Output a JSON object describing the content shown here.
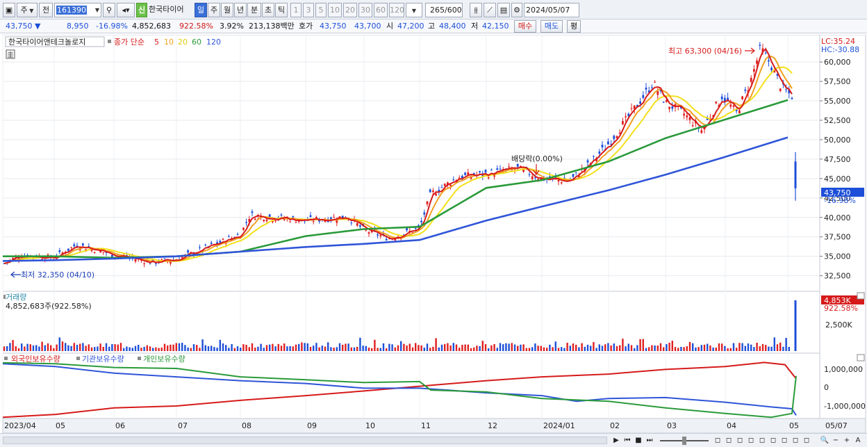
{
  "toolbar": {
    "period_unit": "주",
    "prev_label": "전",
    "code": "161390",
    "new_badge": "신",
    "stock_name": "한국타이어",
    "tabs": [
      "일",
      "주",
      "월",
      "년",
      "분",
      "초",
      "틱"
    ],
    "active_tab": "일",
    "intervals": [
      "1",
      "3",
      "5",
      "10",
      "20",
      "30",
      "60",
      "120"
    ],
    "count": "265",
    "count_total": "/600",
    "date": "2024/05/07"
  },
  "info": {
    "price": "43,750",
    "change": "8,950",
    "change_pct": "-16.98%",
    "volume": "4,852,683",
    "volume_pct": "922.58%",
    "turnover_pct": "3.92%",
    "amount": "213,138백만",
    "quote_label": "호가",
    "ask": "43,750",
    "bid": "43,700",
    "open_label": "시",
    "open": "47,200",
    "high_label": "고",
    "high": "48,400",
    "low_label": "저",
    "low": "42,150",
    "buy_label": "매수",
    "sell_label": "매도",
    "eval_label": "평"
  },
  "chart_data": {
    "type": "line",
    "title": "한국타이어앤테크놀로지",
    "ma_legend_prefix": "종가 단순",
    "ma_periods": [
      "5",
      "10",
      "20",
      "60",
      "120"
    ],
    "ma_colors": {
      "5": "#d61a1a",
      "10": "#f0a020",
      "20": "#f2e01a",
      "60": "#2a9a3a",
      "120": "#2f55d8"
    },
    "y_ticks": [
      "60,000",
      "57,500",
      "55,000",
      "52,500",
      "50,000",
      "47,500",
      "45,000",
      "42,500",
      "40,000",
      "37,500",
      "35,000",
      "32,500"
    ],
    "ylim": [
      30500,
      63500
    ],
    "x_labels": [
      "2023/04",
      "05",
      "06",
      "07",
      "08",
      "09",
      "10",
      "11",
      "12",
      "2024/01",
      "02",
      "03",
      "04",
      "05",
      "05/07"
    ],
    "high_annotation": "최고 63,300 (04/16)",
    "low_annotation": "최저 32,350 (04/10)",
    "dividend_annotation": "배당락(0.00%)",
    "lc_label": "LC:35.24",
    "hc_label": "HC:-30.88",
    "last_price_label": "43,750",
    "last_change_label": "-16.98%",
    "ma60": [
      {
        "x": "2023/04",
        "y": 35000
      },
      {
        "x": "2023/05",
        "y": 35000
      },
      {
        "x": "2023/06",
        "y": 34800
      },
      {
        "x": "2023/07",
        "y": 35000
      },
      {
        "x": "2023/08",
        "y": 35600
      },
      {
        "x": "2023/09",
        "y": 37600
      },
      {
        "x": "2023/10",
        "y": 38500
      },
      {
        "x": "2023/11",
        "y": 38800
      },
      {
        "x": "2023/12",
        "y": 43800
      },
      {
        "x": "2024/01",
        "y": 44800
      },
      {
        "x": "2024/02",
        "y": 47200
      },
      {
        "x": "2024/03",
        "y": 50200
      },
      {
        "x": "2024/04",
        "y": 52600
      },
      {
        "x": "2024/05",
        "y": 55100
      }
    ],
    "ma120": [
      {
        "x": "2023/04",
        "y": 34400
      },
      {
        "x": "2023/05",
        "y": 34500
      },
      {
        "x": "2023/06",
        "y": 34700
      },
      {
        "x": "2023/07",
        "y": 35000
      },
      {
        "x": "2023/08",
        "y": 35600
      },
      {
        "x": "2023/09",
        "y": 36200
      },
      {
        "x": "2023/10",
        "y": 36600
      },
      {
        "x": "2023/11",
        "y": 37100
      },
      {
        "x": "2023/12",
        "y": 39600
      },
      {
        "x": "2024/01",
        "y": 41400
      },
      {
        "x": "2024/02",
        "y": 43500
      },
      {
        "x": "2024/03",
        "y": 45500
      },
      {
        "x": "2024/04",
        "y": 47800
      },
      {
        "x": "2024/05",
        "y": 50300
      }
    ],
    "volume_pane": {
      "title": "거래량",
      "value_label": "4,852,683주(922.58%)",
      "right_value": "4,853K",
      "right_pct": "922.58%",
      "y_tick": "2,500K"
    },
    "holdings_pane": {
      "series_names": [
        "외국인보유수량",
        "기관보유수량",
        "개인보유수량"
      ],
      "series_colors": [
        "#d61a1a",
        "#2f55d8",
        "#2a9a3a"
      ],
      "y_ticks": [
        "1,000,000",
        "0",
        "-1,000,000"
      ]
    }
  },
  "bottombar": {
    "nav_symbols": [
      "▶",
      "⏮",
      "■",
      "⏭"
    ],
    "tool_symbols": [
      "◻",
      "◻",
      "◻",
      "◻",
      "◻",
      "◻",
      "◻",
      "◻",
      "◻",
      "◻",
      "◻"
    ],
    "zoom_symbols": [
      "🔍",
      "−",
      "+",
      "A"
    ]
  }
}
